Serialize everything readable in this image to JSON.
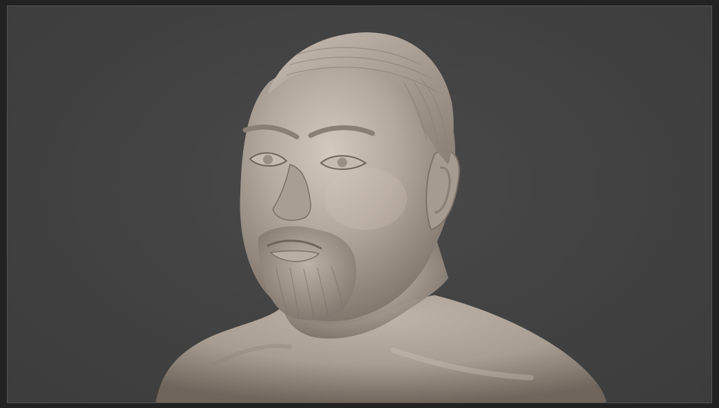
{
  "viewport": {
    "background_color": "#454545",
    "border_color": "#555555",
    "frame_color": "#222222"
  },
  "model": {
    "material_color": "#b3a89d",
    "shadow_color": "#6e645b",
    "highlight_color": "#d6ccc2"
  }
}
